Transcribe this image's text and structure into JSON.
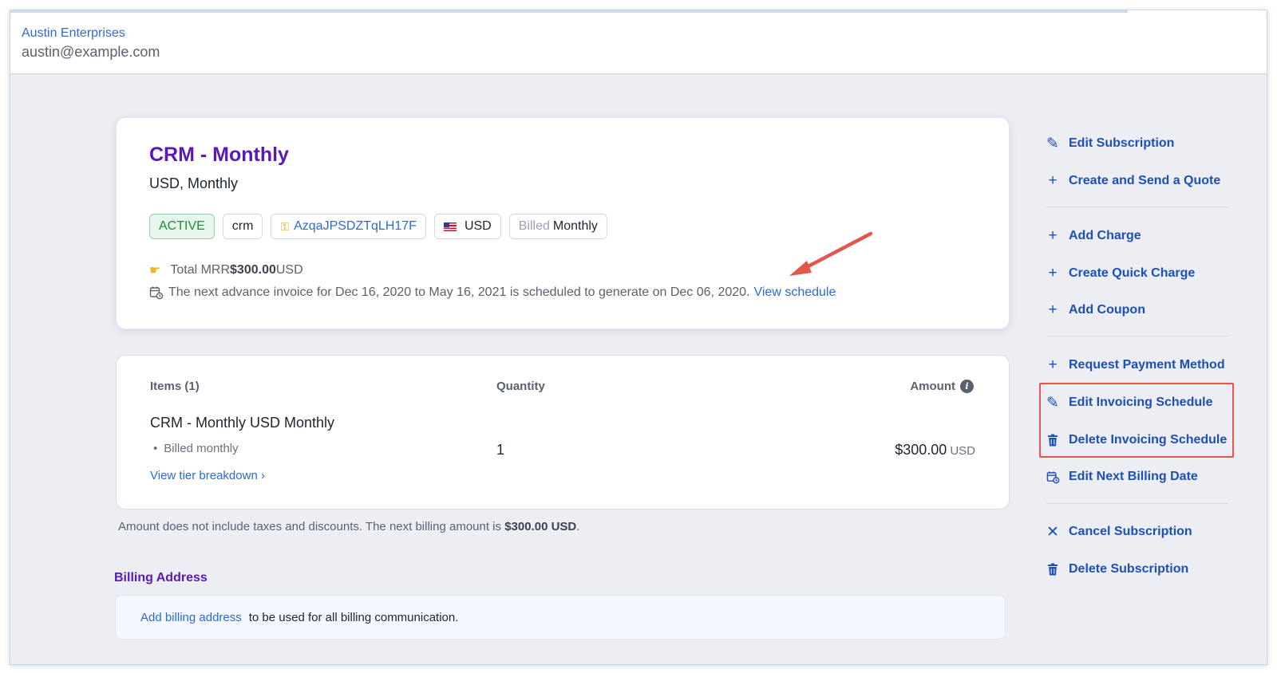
{
  "header": {
    "company": "Austin Enterprises",
    "email": "austin@example.com"
  },
  "subscription": {
    "title": "CRM - Monthly",
    "subtitle": "USD, Monthly",
    "badges": {
      "status": "ACTIVE",
      "product": "crm",
      "id": "AzqaJPSDZTqLH17F",
      "currency": "USD",
      "billed_prefix": "Billed",
      "billed_value": "Monthly"
    },
    "mrr_label": "Total MRR",
    "mrr_value": "$300.00",
    "mrr_currency": "USD",
    "next_invoice_text": "The next advance invoice for Dec 16, 2020 to May 16, 2021 is scheduled to generate on Dec 06, 2020.",
    "view_schedule": "View schedule"
  },
  "items": {
    "header_items": "Items (1)",
    "header_quantity": "Quantity",
    "header_amount": "Amount",
    "row": {
      "name": "CRM - Monthly USD Monthly",
      "billing": "Billed monthly",
      "quantity": "1",
      "amount": "$300.00",
      "currency": "USD"
    },
    "tier_link": "View tier breakdown"
  },
  "note": {
    "text": "Amount does not include taxes and discounts. The next billing amount is",
    "amount": "$300.00 USD",
    "end": "."
  },
  "billing_address": {
    "title": "Billing Address",
    "link": "Add billing address",
    "text": "to be used for all billing communication."
  },
  "actions": {
    "edit_subscription": "Edit Subscription",
    "create_quote": "Create and Send a Quote",
    "add_charge": "Add Charge",
    "quick_charge": "Create Quick Charge",
    "add_coupon": "Add Coupon",
    "request_payment": "Request Payment Method",
    "edit_invoicing": "Edit Invoicing Schedule",
    "delete_invoicing": "Delete Invoicing Schedule",
    "edit_billing_date": "Edit Next Billing Date",
    "cancel_subscription": "Cancel Subscription",
    "delete_subscription": "Delete Subscription"
  },
  "colors": {
    "accent": "#2a6bd6",
    "title": "#5a19b5",
    "highlight": "#e2574c",
    "active": "#1f8a3a"
  }
}
